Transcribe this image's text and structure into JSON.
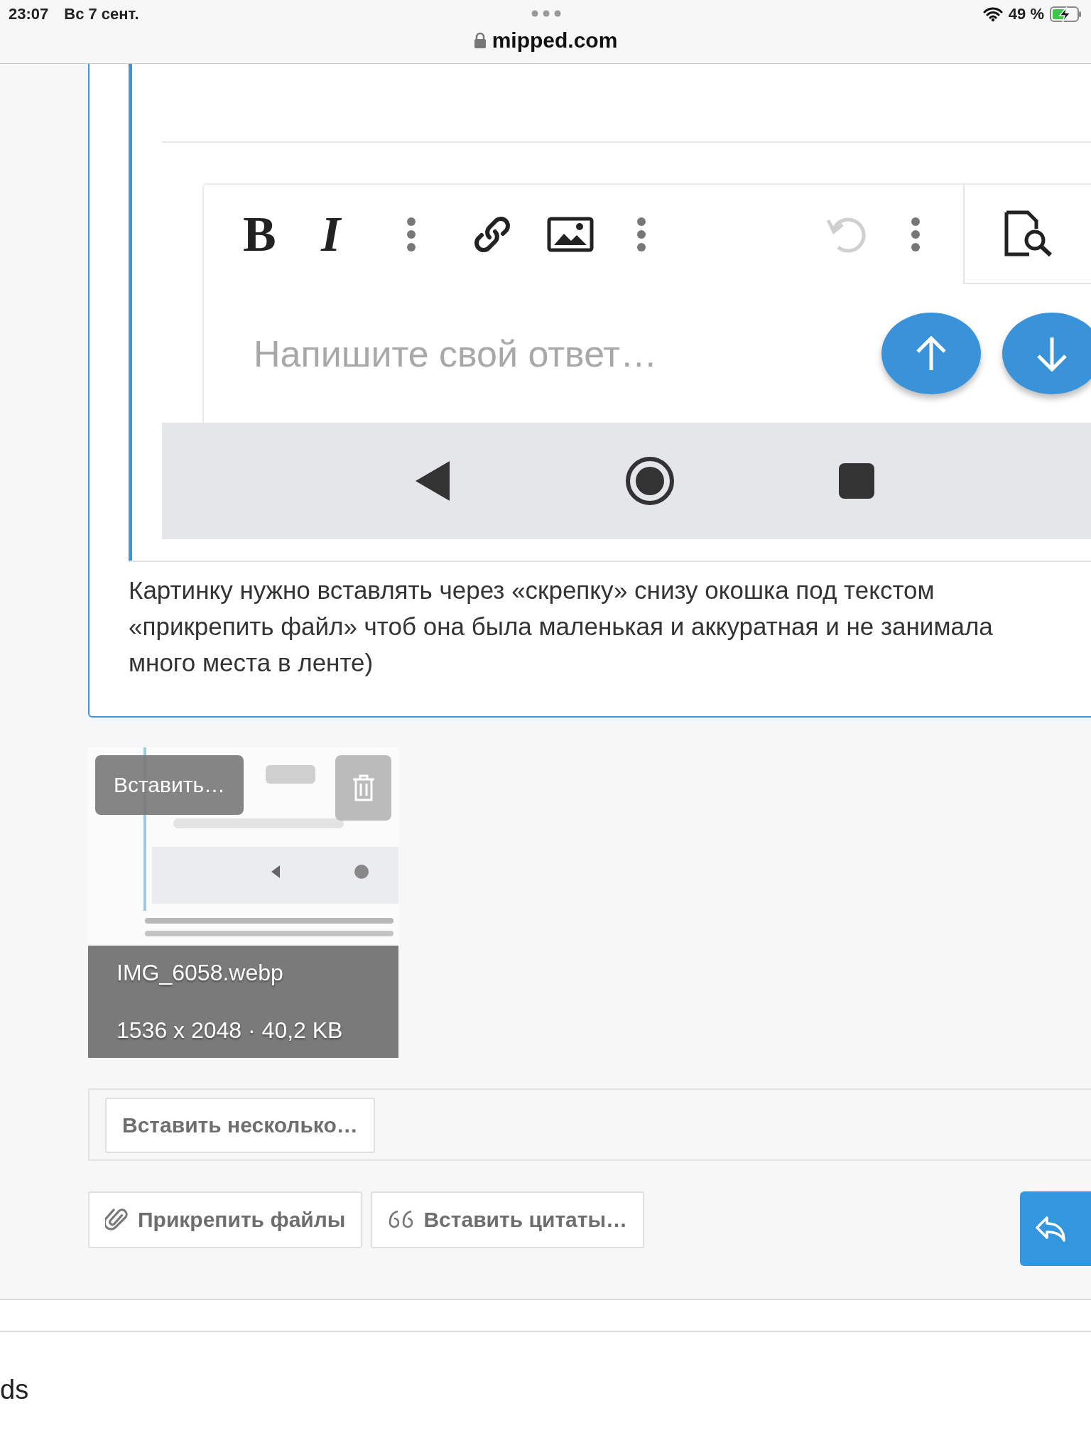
{
  "status_bar": {
    "time": "23:07",
    "date": "Вс 7 сент.",
    "battery": "49 %",
    "charging": true
  },
  "address_bar": {
    "url": "mipped.com",
    "secure": true
  },
  "post_image": {
    "format_buttons": [
      "B",
      "I"
    ],
    "placeholder": "Напишите свой ответ…"
  },
  "message": "Картинку нужно вставлять через «скрепку» снизу окошка под текстом «прикрепить файл» чтоб она была маленькая и аккуратная и не занимала много места в ленте)",
  "attachment": {
    "insert_label": "Вставить…",
    "filename": "IMG_6058.webp",
    "meta": "1536 x 2048 · 40,2 KB"
  },
  "insert_multiple": "Вставить несколько…",
  "actions": [
    {
      "kind": "attach",
      "label": "Прикрепить файлы"
    },
    {
      "kind": "quote",
      "label": "Вставить цитаты…"
    }
  ],
  "footer_text": "ds"
}
